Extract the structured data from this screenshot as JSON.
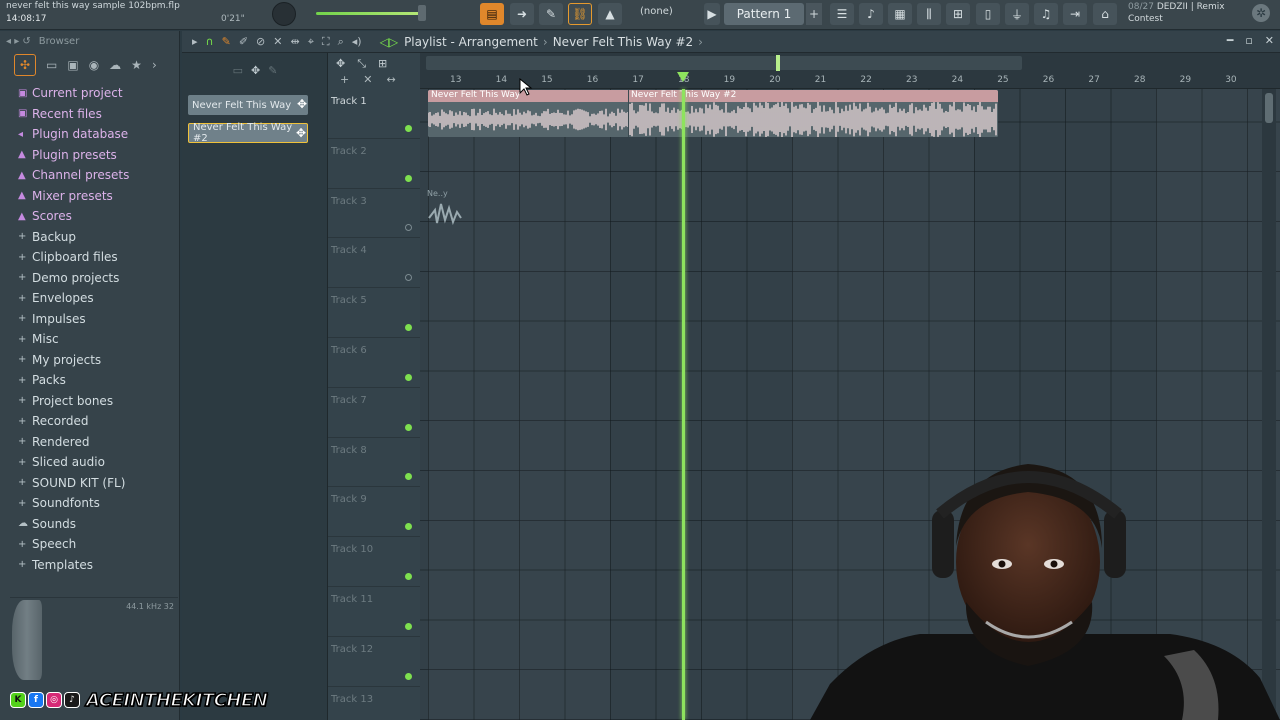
{
  "window": {
    "title": "never felt this way sample 102bpm.flp",
    "clock": "14:08:17",
    "timer": "0'21\""
  },
  "toolbar": {
    "pattern_none": "(none)",
    "pattern_name": "Pattern 1",
    "pattern_add": "+",
    "news_line1": "08/27",
    "news_user": "DEDZII | Remix",
    "news_line2": "Contest"
  },
  "browser": {
    "header": "Browser",
    "items": [
      {
        "label": "Current project",
        "icon": "project-icon",
        "special": true
      },
      {
        "label": "Recent files",
        "icon": "recent-icon",
        "special": true
      },
      {
        "label": "Plugin database",
        "icon": "plugin-db-icon",
        "special": true
      },
      {
        "label": "Plugin presets",
        "icon": "plugin-presets-icon",
        "special": true
      },
      {
        "label": "Channel presets",
        "icon": "channel-presets-icon",
        "special": true
      },
      {
        "label": "Mixer presets",
        "icon": "mixer-presets-icon",
        "special": true
      },
      {
        "label": "Scores",
        "icon": "scores-icon",
        "special": true
      },
      {
        "label": "Backup",
        "icon": "folder-icon",
        "special": false
      },
      {
        "label": "Clipboard files",
        "icon": "folder-icon",
        "special": false
      },
      {
        "label": "Demo projects",
        "icon": "folder-icon",
        "special": false
      },
      {
        "label": "Envelopes",
        "icon": "folder-icon",
        "special": false
      },
      {
        "label": "Impulses",
        "icon": "folder-icon",
        "special": false
      },
      {
        "label": "Misc",
        "icon": "folder-icon",
        "special": false
      },
      {
        "label": "My projects",
        "icon": "folder-icon",
        "special": false
      },
      {
        "label": "Packs",
        "icon": "folder-icon",
        "special": false
      },
      {
        "label": "Project bones",
        "icon": "folder-icon",
        "special": false
      },
      {
        "label": "Recorded",
        "icon": "recorded-icon",
        "special": false
      },
      {
        "label": "Rendered",
        "icon": "folder-icon",
        "special": false
      },
      {
        "label": "Sliced audio",
        "icon": "folder-icon",
        "special": false
      },
      {
        "label": "SOUND KIT (FL)",
        "icon": "folder-icon",
        "special": false
      },
      {
        "label": "Soundfonts",
        "icon": "folder-icon",
        "special": false
      },
      {
        "label": "Sounds",
        "icon": "cloud-icon",
        "special": false
      },
      {
        "label": "Speech",
        "icon": "speech-icon",
        "special": false
      },
      {
        "label": "Templates",
        "icon": "folder-icon",
        "special": false
      }
    ],
    "sample_rate": "44.1 kHz 32"
  },
  "clip_list": [
    {
      "label": "Never Felt This Way",
      "active": false
    },
    {
      "label": "Never Felt This Way #2",
      "active": true
    }
  ],
  "playlist": {
    "view": "Playlist - Arrangement",
    "separator": "›",
    "current_clip": "Never Felt This Way #2",
    "tracks": [
      "Track 1",
      "Track 2",
      "Track 3",
      "Track 4",
      "Track 5",
      "Track 6",
      "Track 7",
      "Track 8",
      "Track 9",
      "Track 10",
      "Track 11",
      "Track 12",
      "Track 13"
    ],
    "bars": [
      "13",
      "14",
      "15",
      "16",
      "17",
      "18",
      "19",
      "20",
      "21",
      "22",
      "23",
      "24",
      "25",
      "26",
      "27",
      "28",
      "29",
      "30"
    ],
    "clip_labels": [
      "Never Felt This Way",
      "Never Felt This Way #2"
    ],
    "ghost_label": "Ne..y"
  },
  "watermark": {
    "brand": "ACEINTHEKITCHEN"
  },
  "colors": {
    "accent_green": "#8ee35e",
    "accent_orange": "#e0872b",
    "clip_header": "#c89ca0"
  }
}
